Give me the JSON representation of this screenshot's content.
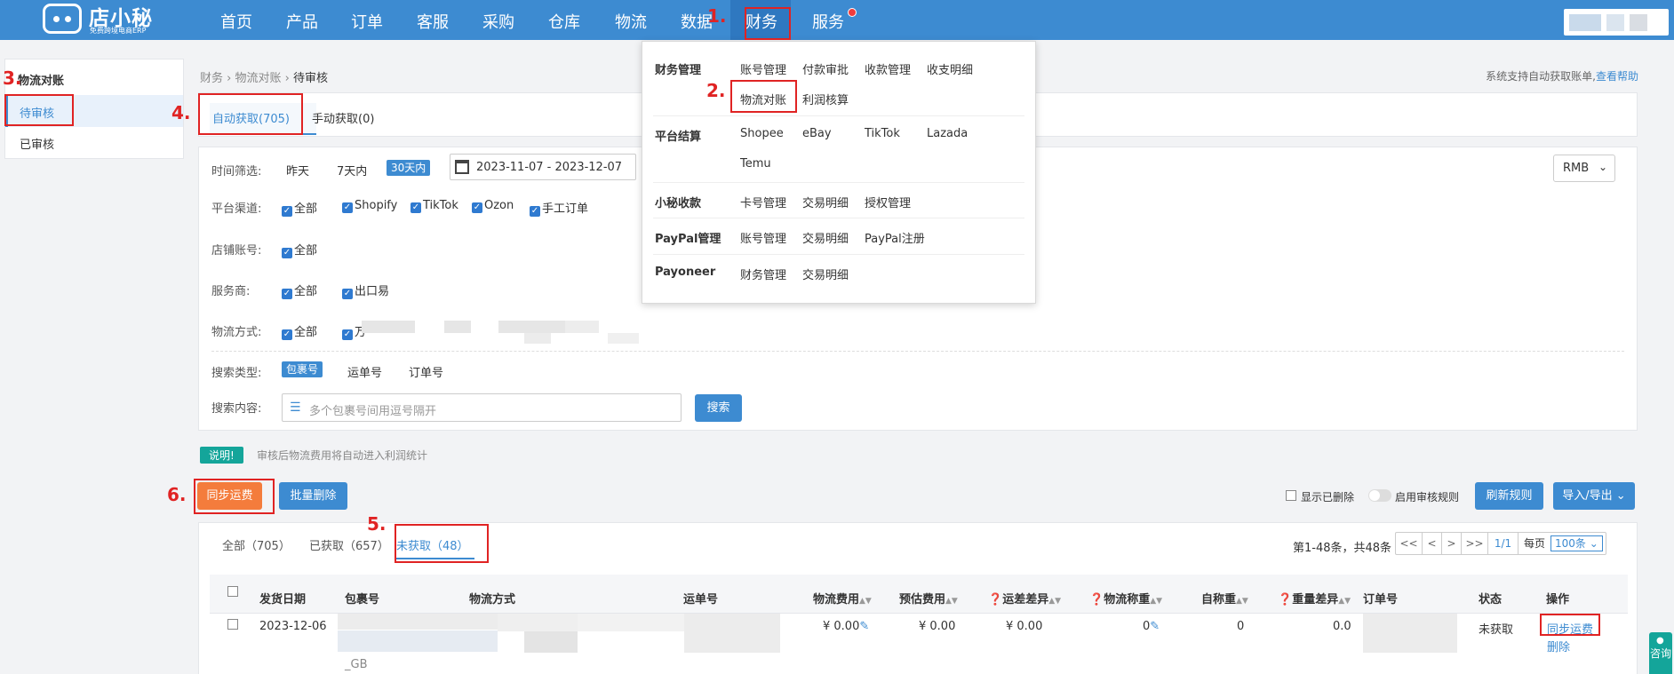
{
  "logo": {
    "name": "店小秘",
    "sub": "免费跨境电商ERP"
  },
  "nav": [
    "首页",
    "产品",
    "订单",
    "客服",
    "采购",
    "仓库",
    "物流",
    "数据",
    "财务",
    "服务"
  ],
  "steps": [
    "1.",
    "2.",
    "3.",
    "4.",
    "5.",
    "6."
  ],
  "sidebar": {
    "title": "物流对账",
    "items": [
      "待审核",
      "已审核"
    ]
  },
  "breadcrumb": {
    "items": [
      "财务",
      "物流对账",
      "待审核"
    ],
    "sep": "›"
  },
  "help": {
    "text": "系统支持自动获取账单,",
    "link": "查看帮助"
  },
  "top_tabs": [
    "自动获取(705)",
    "手动获取(0)"
  ],
  "filters": {
    "time_label": "时间筛选:",
    "time_options": [
      "昨天",
      "7天内",
      "30天内"
    ],
    "date_range": "2023-11-07 - 2023-12-07",
    "currency": "RMB",
    "platform_label": "平台渠道:",
    "platforms": [
      "全部",
      "Shopify",
      "TikTok",
      "Ozon",
      "手工订单"
    ],
    "shop_label": "店铺账号:",
    "shop_all": "全部",
    "provider_label": "服务商:",
    "providers": [
      "全部",
      "出口易"
    ],
    "method_label": "物流方式:",
    "method_all": "全部",
    "method_partial": "万",
    "search_type_label": "搜索类型:",
    "search_types": [
      "包裹号",
      "运单号",
      "订单号"
    ],
    "search_content_label": "搜索内容:",
    "search_placeholder": "多个包裹号间用逗号隔开",
    "search_button": "搜索"
  },
  "note": {
    "badge": "说明!",
    "text": "审核后物流费用将自动进入利润统计"
  },
  "actions": {
    "sync": "同步运费",
    "batch_delete": "批量删除",
    "show_deleted": "显示已删除",
    "enable_rule": "启用审核规则",
    "refresh_rule": "刷新规则",
    "import_export": "导入/导出"
  },
  "sub_tabs": [
    "全部（705）",
    "已获取（657）",
    "未获取（48）"
  ],
  "pagination": {
    "summary": "第1-48条，共48条",
    "first": "<<",
    "prev": "<",
    "next": ">",
    "last": ">>",
    "page": "1/1",
    "per_page_label": "每页",
    "per_page": "100条"
  },
  "table": {
    "columns": [
      "发货日期",
      "包裹号",
      "物流方式",
      "运单号",
      "物流费用",
      "预估费用",
      "运差差异",
      "物流称重",
      "自称重",
      "重量差异",
      "订单号",
      "状态",
      "操作"
    ],
    "row": {
      "date": "2023-12-06",
      "package_suffix": "_GB",
      "fee": "¥ 0.00",
      "estimate": "¥ 0.00",
      "diff": "¥ 0.00",
      "weight": "0",
      "self_weight": "0",
      "weight_diff": "0.0",
      "status": "未获取",
      "op_sync": "同步运费",
      "op_delete": "删除"
    }
  },
  "dropdown": {
    "groups": [
      {
        "title": "财务管理",
        "items": [
          "账号管理",
          "付款审批",
          "收款管理",
          "收支明细",
          "物流对账",
          "利润核算"
        ]
      },
      {
        "title": "平台结算",
        "items": [
          "Shopee",
          "eBay",
          "TikTok",
          "Lazada",
          "Temu"
        ]
      },
      {
        "title": "小秘收款",
        "items": [
          "卡号管理",
          "交易明细",
          "授权管理"
        ]
      },
      {
        "title": "PayPal管理",
        "items": [
          "账号管理",
          "交易明细",
          "PayPal注册"
        ]
      },
      {
        "title": "Payoneer",
        "items": [
          "财务管理",
          "交易明细"
        ]
      }
    ]
  },
  "consult": "咨询"
}
